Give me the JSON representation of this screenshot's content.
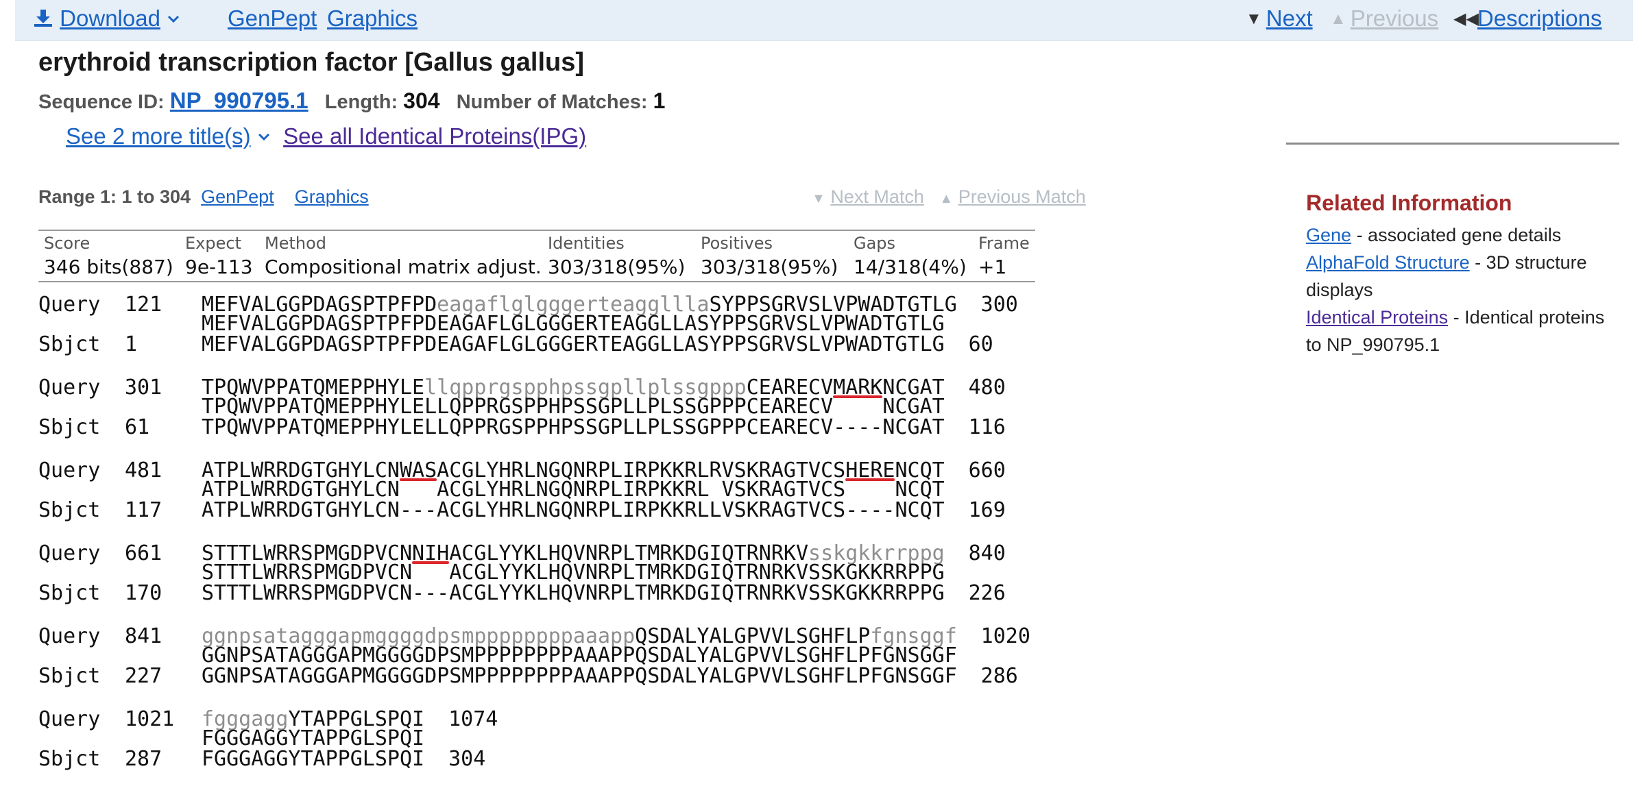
{
  "toolbar": {
    "download_label": "Download",
    "genpept_label": "GenPept",
    "graphics_label": "Graphics",
    "next_label": "Next",
    "previous_label": "Previous",
    "descriptions_label": "Descriptions"
  },
  "header": {
    "title": "erythroid transcription factor [Gallus gallus]",
    "sequence_id_label": "Sequence ID:",
    "sequence_id": "NP_990795.1",
    "length_label": "Length:",
    "length": "304",
    "matches_label": "Number of Matches:",
    "matches": "1",
    "more_titles": "See 2 more title(s)",
    "identical_proteins_link": "See all Identical Proteins(IPG)"
  },
  "range": {
    "label": "Range 1: 1 to 304",
    "genpept": "GenPept",
    "graphics": "Graphics",
    "next_match": "Next Match",
    "previous_match": "Previous Match"
  },
  "stats": {
    "headers": [
      "Score",
      "Expect",
      "Method",
      "Identities",
      "Positives",
      "Gaps",
      "Frame"
    ],
    "values": [
      "346 bits(887)",
      "9e-113",
      "Compositional matrix adjust.",
      "303/318(95%)",
      "303/318(95%)",
      "14/318(4%)",
      "+1"
    ]
  },
  "alignment": [
    {
      "q_label": "Query",
      "q_start": "121",
      "q_end": "300",
      "q_segments": [
        {
          "t": "MEFVALGGPDAGSPTPFPD",
          "low": false
        },
        {
          "t": "eagaflglgggerteaggllla",
          "low": true
        },
        {
          "t": "SYPPSGRVSLVPWADTGTLG",
          "low": false
        }
      ],
      "mid": "MEFVALGGPDAGSPTPFPDEAGAFLGLGGGERTEAGGLLASYPPSGRVSLVPWADTGTLG",
      "s_label": "Sbjct",
      "s_start": "1",
      "s_end": "60",
      "s_seq": "MEFVALGGPDAGSPTPFPDEAGAFLGLGGGERTEAGGLLASYPPSGRVSLVPWADTGTLG"
    },
    {
      "q_label": "Query",
      "q_start": "301",
      "q_end": "480",
      "q_segments": [
        {
          "t": "TPQWVPPATQMEPPHYLE",
          "low": false
        },
        {
          "t": "llqpprgspphpssgpllplssgppp",
          "low": true
        },
        {
          "t": "CEARECVMARKNCGAT",
          "low": false
        }
      ],
      "mid": "TPQWVPPATQMEPPHYLELLQPPRGSPPHPSSGPLLPLSSGPPPCEARECV    NCGAT",
      "s_label": "Sbjct",
      "s_start": "61",
      "s_end": "116",
      "s_seq": "TPQWVPPATQMEPPHYLELLQPPRGSPPHPSSGPLLPLSSGPPPCEARECV----NCGAT"
    },
    {
      "q_label": "Query",
      "q_start": "481",
      "q_end": "660",
      "q_segments": [
        {
          "t": "ATPLWRRDGTGHYLCNWASACGLYHRLNGQNRPLIRPKKRLRVSKRAGTVCSHERENCQT",
          "low": false
        }
      ],
      "mid": "ATPLWRRDGTGHYLCN   ACGLYHRLNGQNRPLIRPKKRL VSKRAGTVCS    NCQT",
      "s_label": "Sbjct",
      "s_start": "117",
      "s_end": "169",
      "s_seq": "ATPLWRRDGTGHYLCN---ACGLYHRLNGQNRPLIRPKKRLLVSKRAGTVCS----NCQT"
    },
    {
      "q_label": "Query",
      "q_start": "661",
      "q_end": "840",
      "q_segments": [
        {
          "t": "STTTLWRRSPMGDPVCNNIHACGLYYKLHQVNRPLTMRKDGIQTRNRKV",
          "low": false
        },
        {
          "t": "sskgkkrrppg",
          "low": true
        }
      ],
      "mid": "STTTLWRRSPMGDPVCN   ACGLYYKLHQVNRPLTMRKDGIQTRNRKVSSKGKKRRPPG",
      "s_label": "Sbjct",
      "s_start": "170",
      "s_end": "226",
      "s_seq": "STTTLWRRSPMGDPVCN---ACGLYYKLHQVNRPLTMRKDGIQTRNRKVSSKGKKRRPPG"
    },
    {
      "q_label": "Query",
      "q_start": "841",
      "q_end": "1020",
      "q_segments": [
        {
          "t": "ggnpsatagggapmggggdpsmppppppppaaapp",
          "low": true
        },
        {
          "t": "QSDALYALGPVVLSGHFLP",
          "low": false
        },
        {
          "t": "fgnsggf",
          "low": true
        }
      ],
      "mid": "GGNPSATAGGGAPMGGGGDPSMPPPPPPPPAAAPPQSDALYALGPVVLSGHFLPFGNSGGF",
      "s_label": "Sbjct",
      "s_start": "227",
      "s_end": "286",
      "s_seq": "GGNPSATAGGGAPMGGGGDPSMPPPPPPPPAAAPPQSDALYALGPVVLSGHFLPFGNSGGF"
    },
    {
      "q_label": "Query",
      "q_start": "1021",
      "q_end": "1074",
      "q_segments": [
        {
          "t": "fgggagg",
          "low": true
        },
        {
          "t": "YTAPPGLSPQI",
          "low": false
        }
      ],
      "mid": "FGGGAGGYTAPPGLSPQI",
      "s_label": "Sbjct",
      "s_start": "287",
      "s_end": "304",
      "s_seq": "FGGGAGGYTAPPGLSPQI"
    }
  ],
  "related": {
    "heading": "Related Information",
    "items": [
      {
        "link": "Gene",
        "desc": " - associated gene details"
      },
      {
        "link": "AlphaFold Structure",
        "desc": " - 3D structure displays"
      },
      {
        "link": "Identical Proteins",
        "desc": " - Identical proteins to NP_990795.1"
      }
    ]
  },
  "colors": {
    "toolbar_bg": "#e6eff7",
    "link": "#1a63c4",
    "visited_link": "#4b2a96",
    "related_heading": "#a52a2a",
    "lowercase_residue": "#8e8e8e",
    "annotation_underline": "#d9262c"
  },
  "icons": [
    "download-icon",
    "chevron-down-icon",
    "triangle-down-icon",
    "triangle-up-icon",
    "double-left-icon"
  ]
}
